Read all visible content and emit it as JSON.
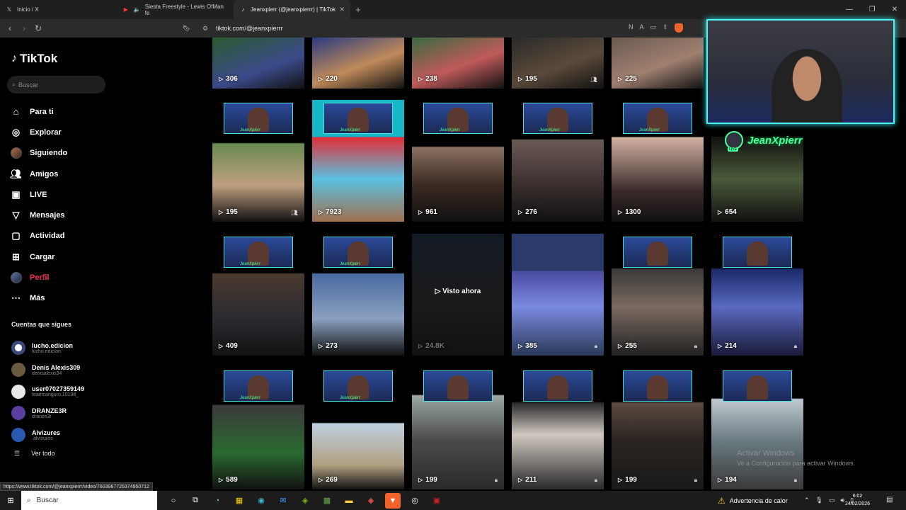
{
  "browser": {
    "tabs": [
      {
        "title": "Inicio / X",
        "icon": "x-icon"
      },
      {
        "title": "Siesta Freestyle - Lewis OfMan fe",
        "icon": "youtube-icon"
      },
      {
        "title": "Jeanxpierr (@jeanxpierrr) | TikTok",
        "icon": "tiktok-icon"
      }
    ],
    "url": "tiktok.com/@jeanxpierrr",
    "status_url": "https://www.tiktok.com/@jeanxpierrr/video/7603967725374950712"
  },
  "sidebar": {
    "logo": "TikTok",
    "search_placeholder": "Buscar",
    "items": [
      {
        "label": "Para ti",
        "icon": "home-icon"
      },
      {
        "label": "Explorar",
        "icon": "compass-icon"
      },
      {
        "label": "Siguiendo",
        "icon": "following-avatar-icon"
      },
      {
        "label": "Amigos",
        "icon": "friends-icon"
      },
      {
        "label": "LIVE",
        "icon": "live-icon"
      },
      {
        "label": "Mensajes",
        "icon": "messages-icon"
      },
      {
        "label": "Actividad",
        "icon": "activity-icon"
      },
      {
        "label": "Cargar",
        "icon": "upload-icon"
      },
      {
        "label": "Perfil",
        "icon": "profile-avatar-icon"
      },
      {
        "label": "Más",
        "icon": "more-icon"
      }
    ],
    "following_title": "Cuentas que sigues",
    "following": [
      {
        "name": "lucho.edicion",
        "handle": "lucho.edicion",
        "color": "#d9d9d9"
      },
      {
        "name": "Denis Alexis309",
        "handle": "denisalexis34",
        "color": "#6a5a40"
      },
      {
        "name": "user07027359149",
        "handle": "teamcanguro.10198_",
        "color": "#e8e8e8"
      },
      {
        "name": "DRANZE3R",
        "handle": "dranze3r",
        "color": "#5a3fa0"
      },
      {
        "name": "Alvizures",
        "handle": ".alvizures",
        "color": "#2a5ab0"
      }
    ],
    "see_all": "Ver todo"
  },
  "videos": [
    {
      "views": "306",
      "badge": ""
    },
    {
      "views": "220",
      "badge": ""
    },
    {
      "views": "238",
      "badge": ""
    },
    {
      "views": "195",
      "badge": "friends"
    },
    {
      "views": "225",
      "badge": ""
    },
    {
      "views": "195",
      "badge": "friends"
    },
    {
      "views": "7923",
      "badge": ""
    },
    {
      "views": "961",
      "badge": ""
    },
    {
      "views": "276",
      "badge": ""
    },
    {
      "views": "1300",
      "badge": ""
    },
    {
      "views": "654",
      "badge": ""
    },
    {
      "views": "409",
      "badge": ""
    },
    {
      "views": "273",
      "badge": ""
    },
    {
      "views": "24.8K",
      "badge": "",
      "watched": "Visto ahora"
    },
    {
      "views": "385",
      "badge": "lock"
    },
    {
      "views": "255",
      "badge": "lock"
    },
    {
      "views": "214",
      "badge": "lock"
    },
    {
      "views": "589",
      "badge": ""
    },
    {
      "views": "269",
      "badge": ""
    },
    {
      "views": "199",
      "badge": "lock"
    },
    {
      "views": "211",
      "badge": "lock"
    },
    {
      "views": "199",
      "badge": "lock"
    },
    {
      "views": "194",
      "badge": "lock"
    }
  ],
  "overlay": {
    "streamer_name": "JeanXpierr",
    "live_tag": "LIVE"
  },
  "watermark": {
    "line1": "Activar Windows",
    "line2": "Ve a Configuración para activar Windows."
  },
  "taskbar": {
    "search_placeholder": "Buscar",
    "weather": "Advertencia de calor",
    "time": "6:02",
    "date": "24/02/2026"
  }
}
